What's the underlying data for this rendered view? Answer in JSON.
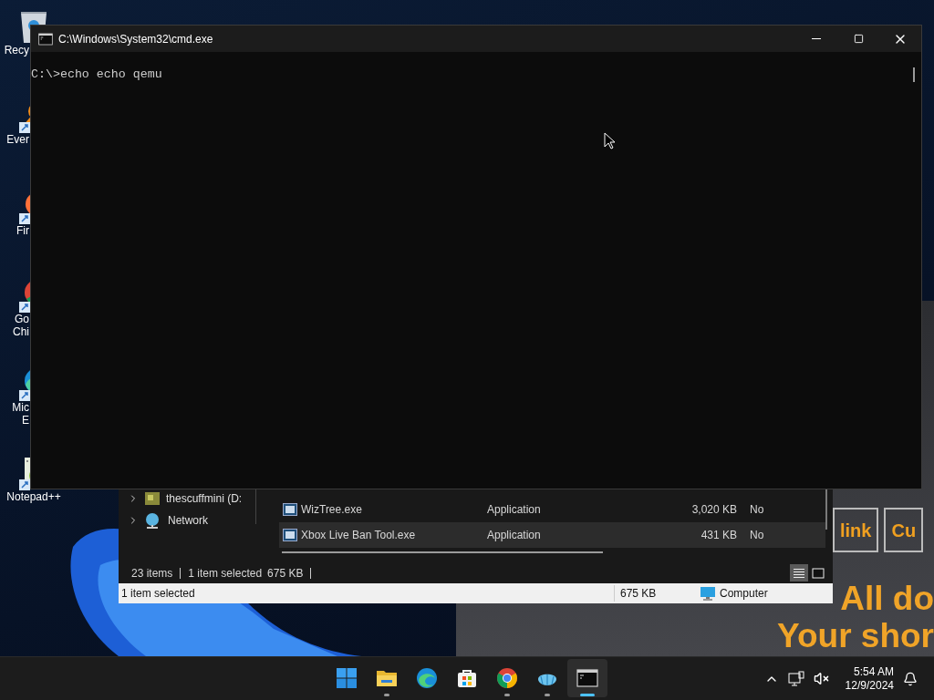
{
  "desktop_icons": [
    {
      "kind": "recycle",
      "lines": [
        "Recy"
      ]
    },
    {
      "kind": "everything",
      "lines": [
        "Ever"
      ]
    },
    {
      "kind": "firefox",
      "lines": [
        "Fir"
      ]
    },
    {
      "kind": "chrome",
      "lines": [
        "Go",
        "Chi"
      ]
    },
    {
      "kind": "edge",
      "lines": [
        "Mic",
        "E"
      ]
    },
    {
      "kind": "notepad",
      "lines": [
        "Notepad++"
      ]
    }
  ],
  "browser_page": {
    "buttons": [
      "link",
      "Cu"
    ],
    "headline": [
      "All do",
      "Your shor"
    ]
  },
  "explorer": {
    "nav_items": [
      {
        "kind": "drive",
        "label": "thescuffmini (D:"
      },
      {
        "kind": "network",
        "label": "Network"
      }
    ],
    "rows": [
      {
        "name": "WizTree.exe",
        "type": "Application",
        "size": "3,020 KB",
        "column_4": "No",
        "selected": false
      },
      {
        "name": "Xbox Live Ban Tool.exe",
        "type": "Application",
        "size": "431 KB",
        "column_4": "No",
        "selected": true
      }
    ],
    "status": {
      "items": "23 items",
      "selection": "1 item selected",
      "size": "675 KB"
    },
    "view_buttons": [
      {
        "kind": "details",
        "selected": true
      },
      {
        "kind": "tiles",
        "selected": false
      }
    ],
    "classic_status": {
      "text": "1 item selected",
      "size": "675 KB",
      "zone": "Computer"
    }
  },
  "cmd_window": {
    "title": "C:\\Windows\\System32\\cmd.exe",
    "lines": [
      "C:\\>echo echo qemu"
    ]
  },
  "taskbar": {
    "apps": [
      {
        "kind": "start",
        "running": false,
        "selected": false
      },
      {
        "kind": "explorer",
        "running": true,
        "selected": false
      },
      {
        "kind": "edge",
        "running": false,
        "selected": false
      },
      {
        "kind": "store",
        "running": false,
        "selected": false
      },
      {
        "kind": "chrome",
        "running": true,
        "selected": false
      },
      {
        "kind": "shell",
        "running": true,
        "selected": false
      },
      {
        "kind": "terminal",
        "running": true,
        "selected": true
      }
    ],
    "clock": {
      "time": "5:54 AM",
      "date": "12/9/2024"
    }
  }
}
